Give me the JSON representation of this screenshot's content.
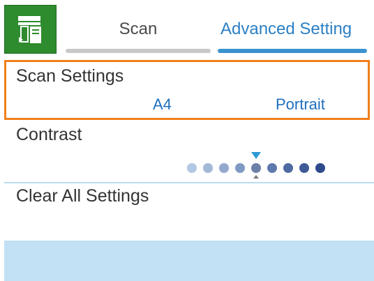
{
  "tabs": [
    {
      "label": "Scan",
      "selected": false
    },
    {
      "label": "Advanced Setting",
      "selected": true
    }
  ],
  "app_icon": {
    "name": "scan-app-icon"
  },
  "scan_settings": {
    "title": "Scan Settings",
    "paper_size": "A4",
    "orientation": "Portrait"
  },
  "contrast": {
    "title": "Contrast",
    "level": 5,
    "total_levels": 9
  },
  "clear_all": {
    "label": "Clear All Settings"
  },
  "colors": {
    "accent_blue": "#2b7fc4",
    "selection_orange": "#ef7f1a",
    "app_green": "#2e8b2e",
    "bottom_bar": "#c2e1f4"
  }
}
